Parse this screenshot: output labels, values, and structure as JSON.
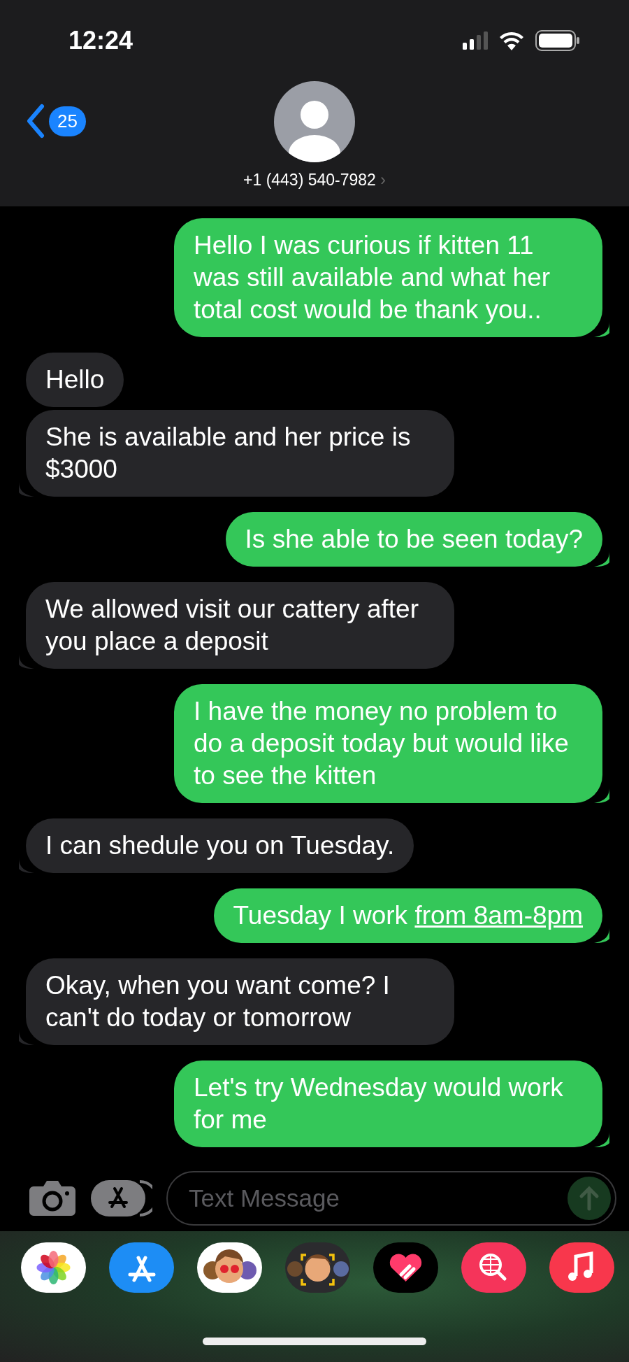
{
  "status_bar": {
    "time": "12:24"
  },
  "header": {
    "back_count": "25",
    "contact": "+1 (443) 540-7982",
    "chevron": "›"
  },
  "messages": [
    {
      "kind": "sent",
      "text": "Hello I was curious if kitten 11 was still available and what her total cost would be thank you.."
    },
    {
      "kind": "received",
      "text": "Hello"
    },
    {
      "kind": "received",
      "text": "She is available and her price is $3000"
    },
    {
      "kind": "sent",
      "text": "Is she able to be seen today?"
    },
    {
      "kind": "received",
      "text": "We allowed visit our cattery after you place a deposit"
    },
    {
      "kind": "sent",
      "text": "I have the money no problem to do a deposit today but would like to see the kitten"
    },
    {
      "kind": "received",
      "text": "I can shedule you on Tuesday."
    },
    {
      "kind": "sent",
      "text": "Tuesday I work",
      "link": "from 8am-8pm"
    },
    {
      "kind": "received",
      "text": "Okay, when you want come? I can't do today or tomorrow"
    },
    {
      "kind": "sent",
      "text": "Let's try Wednesday would work for me"
    }
  ],
  "composer": {
    "placeholder": "Text Message"
  }
}
